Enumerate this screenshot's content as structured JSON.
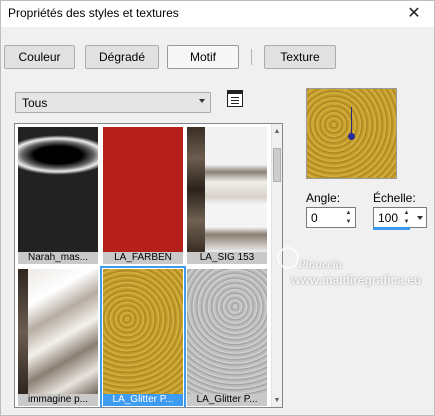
{
  "window": {
    "title": "Propriétés des styles et textures",
    "close_glyph": "✕"
  },
  "tabs": [
    {
      "label": "Couleur",
      "active": false
    },
    {
      "label": "Dégradé",
      "active": false
    },
    {
      "label": "Motif",
      "active": true
    },
    {
      "label": "Texture",
      "active": false
    }
  ],
  "category_select": {
    "value": "Tous"
  },
  "gallery": {
    "items": [
      {
        "label": "Narah_mas...",
        "selected": false
      },
      {
        "label": "LA_FARBEN",
        "selected": false
      },
      {
        "label": "LA_SIG 153",
        "selected": false
      },
      {
        "label": "immagine p...",
        "selected": false
      },
      {
        "label": "LA_Glitter P...",
        "selected": true
      },
      {
        "label": "LA_Glitter P...",
        "selected": false
      }
    ]
  },
  "angle": {
    "label": "Angle:",
    "value": "0"
  },
  "scale": {
    "label": "Échelle:",
    "value": "100"
  },
  "watermark": {
    "name": "Pinuccia",
    "site": "www.maidiregrafica.eu"
  },
  "colors": {
    "accent": "#3d9bf2",
    "farben_red": "#b5201c",
    "gold": "#c29b2c"
  }
}
